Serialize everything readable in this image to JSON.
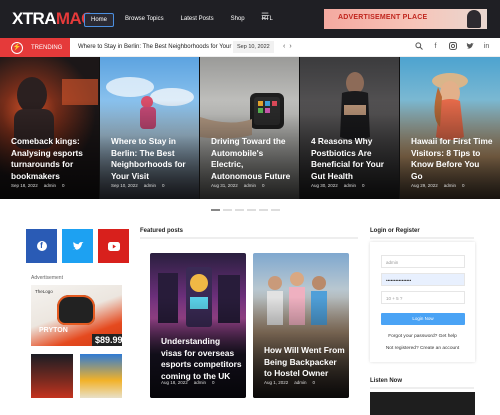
{
  "header": {
    "logo": {
      "part1": "XTRA",
      "part2": "MAG"
    },
    "nav": [
      {
        "label": "Home",
        "active": true
      },
      {
        "label": "Browse Topics",
        "active": false
      },
      {
        "label": "Latest Posts",
        "active": false
      },
      {
        "label": "Shop",
        "active": false
      },
      {
        "label": "RTL",
        "active": false
      }
    ],
    "menu_icon": "hamburger-icon",
    "ad_text": "ADVERTISEMENT PLACE"
  },
  "trending": {
    "label": "TRENDING",
    "headline": "Where to Stay in Berlin: The Best Neighborhoods for Your Visit",
    "date": "Sep 10, 2022",
    "prev": "‹",
    "next": "›",
    "icons": [
      "search-icon",
      "facebook-icon",
      "instagram-icon",
      "twitter-icon",
      "linkedin-icon"
    ]
  },
  "hero_slides": [
    {
      "title": "Comeback kings: Analysing esports turnarounds for bookmakers",
      "date": "Sep 18, 2022",
      "author": "admin",
      "comments": "0"
    },
    {
      "title": "Where to Stay in Berlin: The Best Neighborhoods for Your Visit",
      "date": "Sep 10, 2022",
      "author": "admin",
      "comments": "0"
    },
    {
      "title": "Driving Toward the Automobile's Electric, Autonomous Future",
      "date": "Aug 31, 2022",
      "author": "admin",
      "comments": "0"
    },
    {
      "title": "4 Reasons Why Postbiotics Are Beneficial for Your Gut Health",
      "date": "Aug 30, 2022",
      "author": "admin",
      "comments": "0"
    },
    {
      "title": "Hawaii for First Time Visitors: 8 Tips to Know Before You Go",
      "date": "Aug 29, 2022",
      "author": "admin",
      "comments": "0"
    }
  ],
  "slider_dots": {
    "count": 6,
    "active_index": 0
  },
  "sidebar_left": {
    "social": [
      {
        "name": "facebook-icon",
        "color": "#2a5bb5",
        "glyph": "f"
      },
      {
        "name": "twitter-icon",
        "color": "#1da1f2",
        "glyph": "t"
      },
      {
        "name": "youtube-icon",
        "color": "#d8201c",
        "glyph": "▶"
      }
    ],
    "ad_label": "Advertisement",
    "ad_brand": "TheLogo",
    "ad_model": "PRYTON",
    "ad_price": "$89.99"
  },
  "featured": {
    "heading": "Featured posts",
    "posts": [
      {
        "title": "Understanding visas for overseas esports competitors coming to the UK",
        "date": "Aug 18, 2022",
        "author": "admin",
        "comments": "0"
      },
      {
        "title": "How Will Went From Being Backpacker to Hostel Owner",
        "date": "Aug 1, 2022",
        "author": "admin",
        "comments": "0"
      }
    ]
  },
  "login": {
    "heading": "Login or Register",
    "username_placeholder": "admin",
    "password_value": "••••••••••••••••",
    "captcha_placeholder": "10 + 5 ?",
    "button": "Login Now",
    "forgot": "Forgot your password? Get help",
    "register": "Not registered? Create an account"
  },
  "listen": {
    "heading": "Listen Now"
  }
}
